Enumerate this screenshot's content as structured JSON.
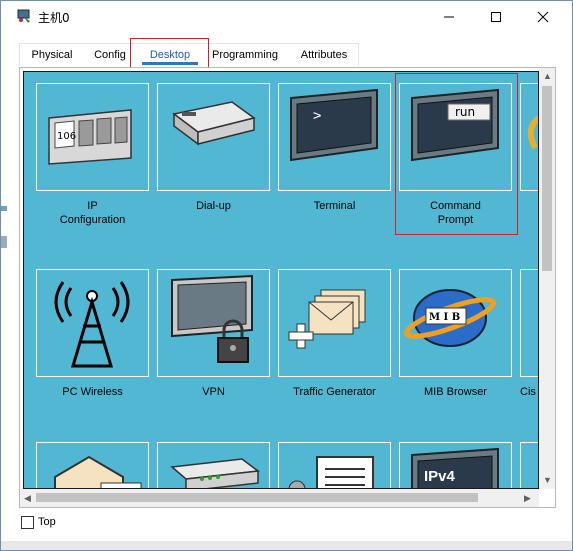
{
  "window": {
    "title": "主机0",
    "minimize_symbol": "—",
    "maximize_symbol": "☐",
    "close_symbol": "✕"
  },
  "tabs": [
    {
      "label": "Physical"
    },
    {
      "label": "Config"
    },
    {
      "label": "Desktop",
      "active": true
    },
    {
      "label": "Programming"
    },
    {
      "label": "Attributes"
    }
  ],
  "desktop": {
    "apps": [
      {
        "label_line1": "IP",
        "label_line2": "Configuration",
        "icon": "ip-config-icon",
        "icon_text": "106"
      },
      {
        "label_line1": "Dial-up",
        "label_line2": "",
        "icon": "modem-icon"
      },
      {
        "label_line1": "Terminal",
        "label_line2": "",
        "icon": "terminal-icon",
        "icon_text": ">"
      },
      {
        "label_line1": "Command",
        "label_line2": "Prompt",
        "icon": "command-prompt-icon",
        "icon_text": "run",
        "highlighted": true
      },
      {
        "label_line1": "PC Wireless",
        "label_line2": "",
        "icon": "wireless-tower-icon"
      },
      {
        "label_line1": "VPN",
        "label_line2": "",
        "icon": "vpn-lock-icon"
      },
      {
        "label_line1": "Traffic Generator",
        "label_line2": "",
        "icon": "traffic-generator-icon"
      },
      {
        "label_line1": "MIB Browser",
        "label_line2": "",
        "icon": "mib-browser-icon",
        "icon_text": "M I B"
      },
      {
        "label_line1": "Cis",
        "label_line2": "",
        "icon": "partial-app-icon"
      },
      {
        "label_line1": "",
        "label_line2": "",
        "icon": "email-icon"
      },
      {
        "label_line1": "",
        "label_line2": "",
        "icon": "device-icon"
      },
      {
        "label_line1": "",
        "label_line2": "",
        "icon": "document-icon"
      },
      {
        "label_line1": "",
        "label_line2": "",
        "icon": "ipv6-config-icon",
        "icon_text": "IPv4"
      }
    ]
  },
  "footer": {
    "always_on_top_label": "Top",
    "always_on_top_checked": false
  },
  "colors": {
    "desktop_bg": "#52b7d2",
    "highlight": "#d0202a",
    "active_tab": "#2a79c9"
  }
}
